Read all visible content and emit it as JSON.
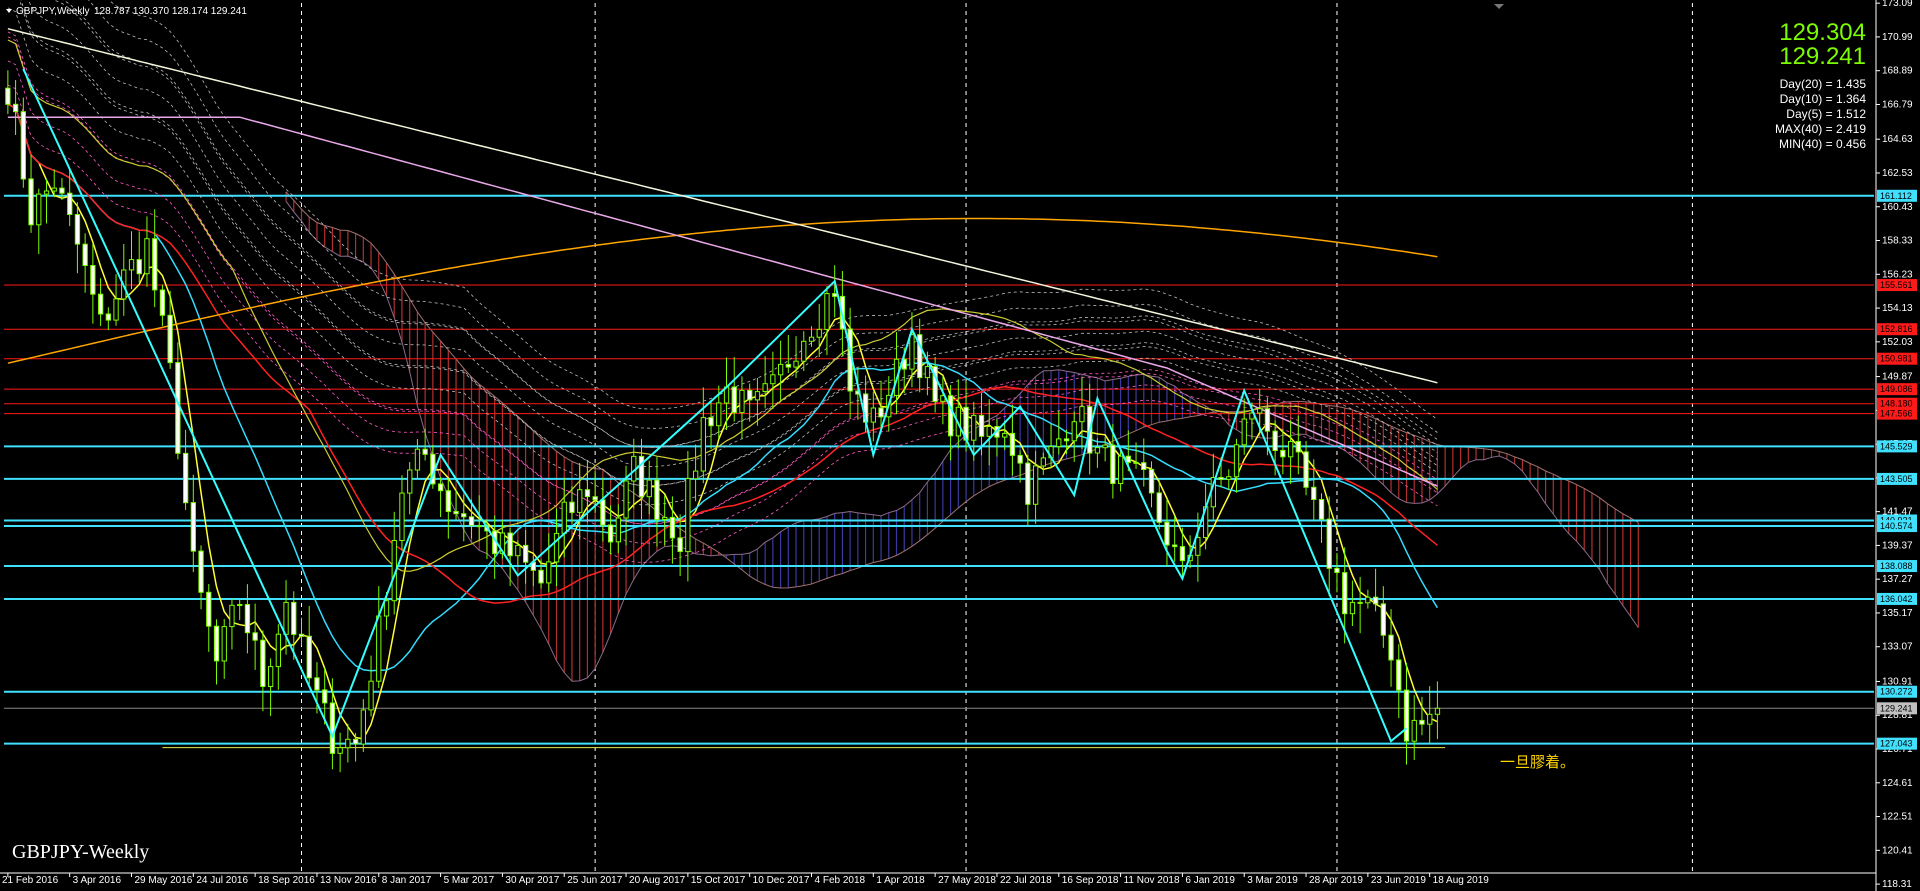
{
  "header": {
    "symbol": "GBPJPY,Weekly",
    "ohlc": "128.787 130.370 128.174 129.241"
  },
  "quote": {
    "bid": "129.304",
    "ask": "129.241"
  },
  "stats": [
    "Day(20) = 1.435",
    "Day(10) = 1.364",
    "Day(5) = 1.512",
    "MAX(40) = 2.419",
    "MIN(40) = 0.456"
  ],
  "watermark": "GBPJPY-Weekly",
  "annotation": "一旦膠着。",
  "colors": {
    "background": "#000000",
    "candle_up": "#7cfc00",
    "candle_up_body": "#000000",
    "candle_down_body": "#ffffff",
    "grid": "#ffffff",
    "level_cyan": "#40e0ff",
    "level_red": "#ff1a1a",
    "ma_yellow": "#ffff33",
    "ma_cyan": "#33ddff",
    "ma_red": "#ff2222",
    "ma_orange": "#ffa500",
    "ma_pink": "#e9a8e9",
    "ma_white": "#f5f5dc",
    "zigzag": "#33ffff",
    "cloud_red": "#b03030",
    "cloud_blue": "#3a3aa0"
  },
  "chart_data": {
    "type": "candlestick",
    "title": "GBPJPY,Weekly",
    "ylim": [
      119.0,
      173.1
    ],
    "y_ticks": [
      173.09,
      170.99,
      168.89,
      166.79,
      164.63,
      162.53,
      160.43,
      158.33,
      156.23,
      154.13,
      152.03,
      149.87,
      147.77,
      145.67,
      143.57,
      141.47,
      139.37,
      137.27,
      135.17,
      133.07,
      130.91,
      128.81,
      126.71,
      124.61,
      122.51,
      120.41,
      118.31
    ],
    "x_labels": [
      "21 Feb 2016",
      "3 Apr 2016",
      "29 May 2016",
      "24 Jul 2016",
      "18 Sep 2016",
      "13 Nov 2016",
      "8 Jan 2017",
      "5 Mar 2017",
      "30 Apr 2017",
      "25 Jun 2017",
      "20 Aug 2017",
      "15 Oct 2017",
      "10 Dec 2017",
      "4 Feb 2018",
      "1 Apr 2018",
      "27 May 2018",
      "22 Jul 2018",
      "16 Sep 2018",
      "11 Nov 2018",
      "6 Jan 2019",
      "3 Mar 2019",
      "28 Apr 2019",
      "23 Jun 2019",
      "18 Aug 2019"
    ],
    "bar_count": 186,
    "vertical_grid_weeks": [
      38,
      76,
      124,
      172,
      218
    ],
    "current_price": 129.241,
    "levels_cyan": [
      161.112,
      145.529,
      143.505,
      140.921,
      140.574,
      138.088,
      136.042,
      130.272,
      127.043
    ],
    "levels_red": [
      155.561,
      152.816,
      150.981,
      149.086,
      148.18,
      147.566
    ],
    "level_tags": [
      {
        "value": 161.112,
        "label": "161.112",
        "color": "#40e0ff"
      },
      {
        "value": 155.561,
        "label": "155.561",
        "color": "#ff1a1a"
      },
      {
        "value": 152.816,
        "label": "152.816",
        "color": "#ff1a1a"
      },
      {
        "value": 150.981,
        "label": "150.981",
        "color": "#ff1a1a"
      },
      {
        "value": 149.086,
        "label": "149.086",
        "color": "#ff1a1a"
      },
      {
        "value": 148.18,
        "label": "148.180",
        "color": "#ff1a1a"
      },
      {
        "value": 147.566,
        "label": "147.566",
        "color": "#ff1a1a"
      },
      {
        "value": 145.529,
        "label": "145.529",
        "color": "#40e0ff"
      },
      {
        "value": 143.505,
        "label": "143.505",
        "color": "#40e0ff"
      },
      {
        "value": 140.921,
        "label": "140.921",
        "color": "#40e0ff"
      },
      {
        "value": 140.574,
        "label": "140.574",
        "color": "#40e0ff"
      },
      {
        "value": 138.088,
        "label": "138.088",
        "color": "#40e0ff"
      },
      {
        "value": 136.042,
        "label": "136.042",
        "color": "#40e0ff"
      },
      {
        "value": 130.272,
        "label": "130.272",
        "color": "#40e0ff"
      },
      {
        "value": 129.241,
        "label": "129.241",
        "color": "#c0c0c0"
      },
      {
        "value": 127.043,
        "label": "127.043",
        "color": "#40e0ff"
      }
    ],
    "trendline_yellow": {
      "from_week": 20,
      "to_week": 186,
      "value": 126.8
    },
    "close_anchors": [
      [
        0,
        168.0
      ],
      [
        3,
        160.0
      ],
      [
        6,
        162.0
      ],
      [
        9,
        158.0
      ],
      [
        12,
        153.0
      ],
      [
        15,
        156.0
      ],
      [
        18,
        158.0
      ],
      [
        21,
        150.0
      ],
      [
        24,
        138.0
      ],
      [
        27,
        132.0
      ],
      [
        30,
        136.0
      ],
      [
        33,
        131.0
      ],
      [
        36,
        136.0
      ],
      [
        39,
        131.0
      ],
      [
        42,
        127.5
      ],
      [
        45,
        127.0
      ],
      [
        48,
        134.0
      ],
      [
        51,
        143.0
      ],
      [
        54,
        145.0
      ],
      [
        57,
        142.0
      ],
      [
        60,
        141.0
      ],
      [
        63,
        139.5
      ],
      [
        66,
        138.5
      ],
      [
        69,
        137.0
      ],
      [
        72,
        141.0
      ],
      [
        75,
        143.0
      ],
      [
        78,
        140.0
      ],
      [
        81,
        144.0
      ],
      [
        84,
        142.0
      ],
      [
        87,
        140.0
      ],
      [
        90,
        147.0
      ],
      [
        93,
        149.0
      ],
      [
        96,
        147.5
      ],
      [
        99,
        149.0
      ],
      [
        102,
        152.0
      ],
      [
        105,
        154.0
      ],
      [
        107,
        155.5
      ],
      [
        109,
        149.0
      ],
      [
        112,
        147.0
      ],
      [
        115,
        150.0
      ],
      [
        117,
        152.5
      ],
      [
        120,
        148.0
      ],
      [
        123,
        147.0
      ],
      [
        126,
        146.0
      ],
      [
        129,
        147.0
      ],
      [
        132,
        143.0
      ],
      [
        135,
        145.0
      ],
      [
        138,
        148.0
      ],
      [
        141,
        145.0
      ],
      [
        144,
        144.0
      ],
      [
        147,
        143.0
      ],
      [
        150,
        140.0
      ],
      [
        152,
        137.5
      ],
      [
        155,
        142.0
      ],
      [
        158,
        144.0
      ],
      [
        161,
        148.0
      ],
      [
        164,
        146.0
      ],
      [
        167,
        144.0
      ],
      [
        170,
        140.0
      ],
      [
        173,
        136.0
      ],
      [
        176,
        135.5
      ],
      [
        179,
        133.0
      ],
      [
        181,
        128.0
      ],
      [
        183,
        128.2
      ],
      [
        185,
        129.241
      ]
    ]
  }
}
